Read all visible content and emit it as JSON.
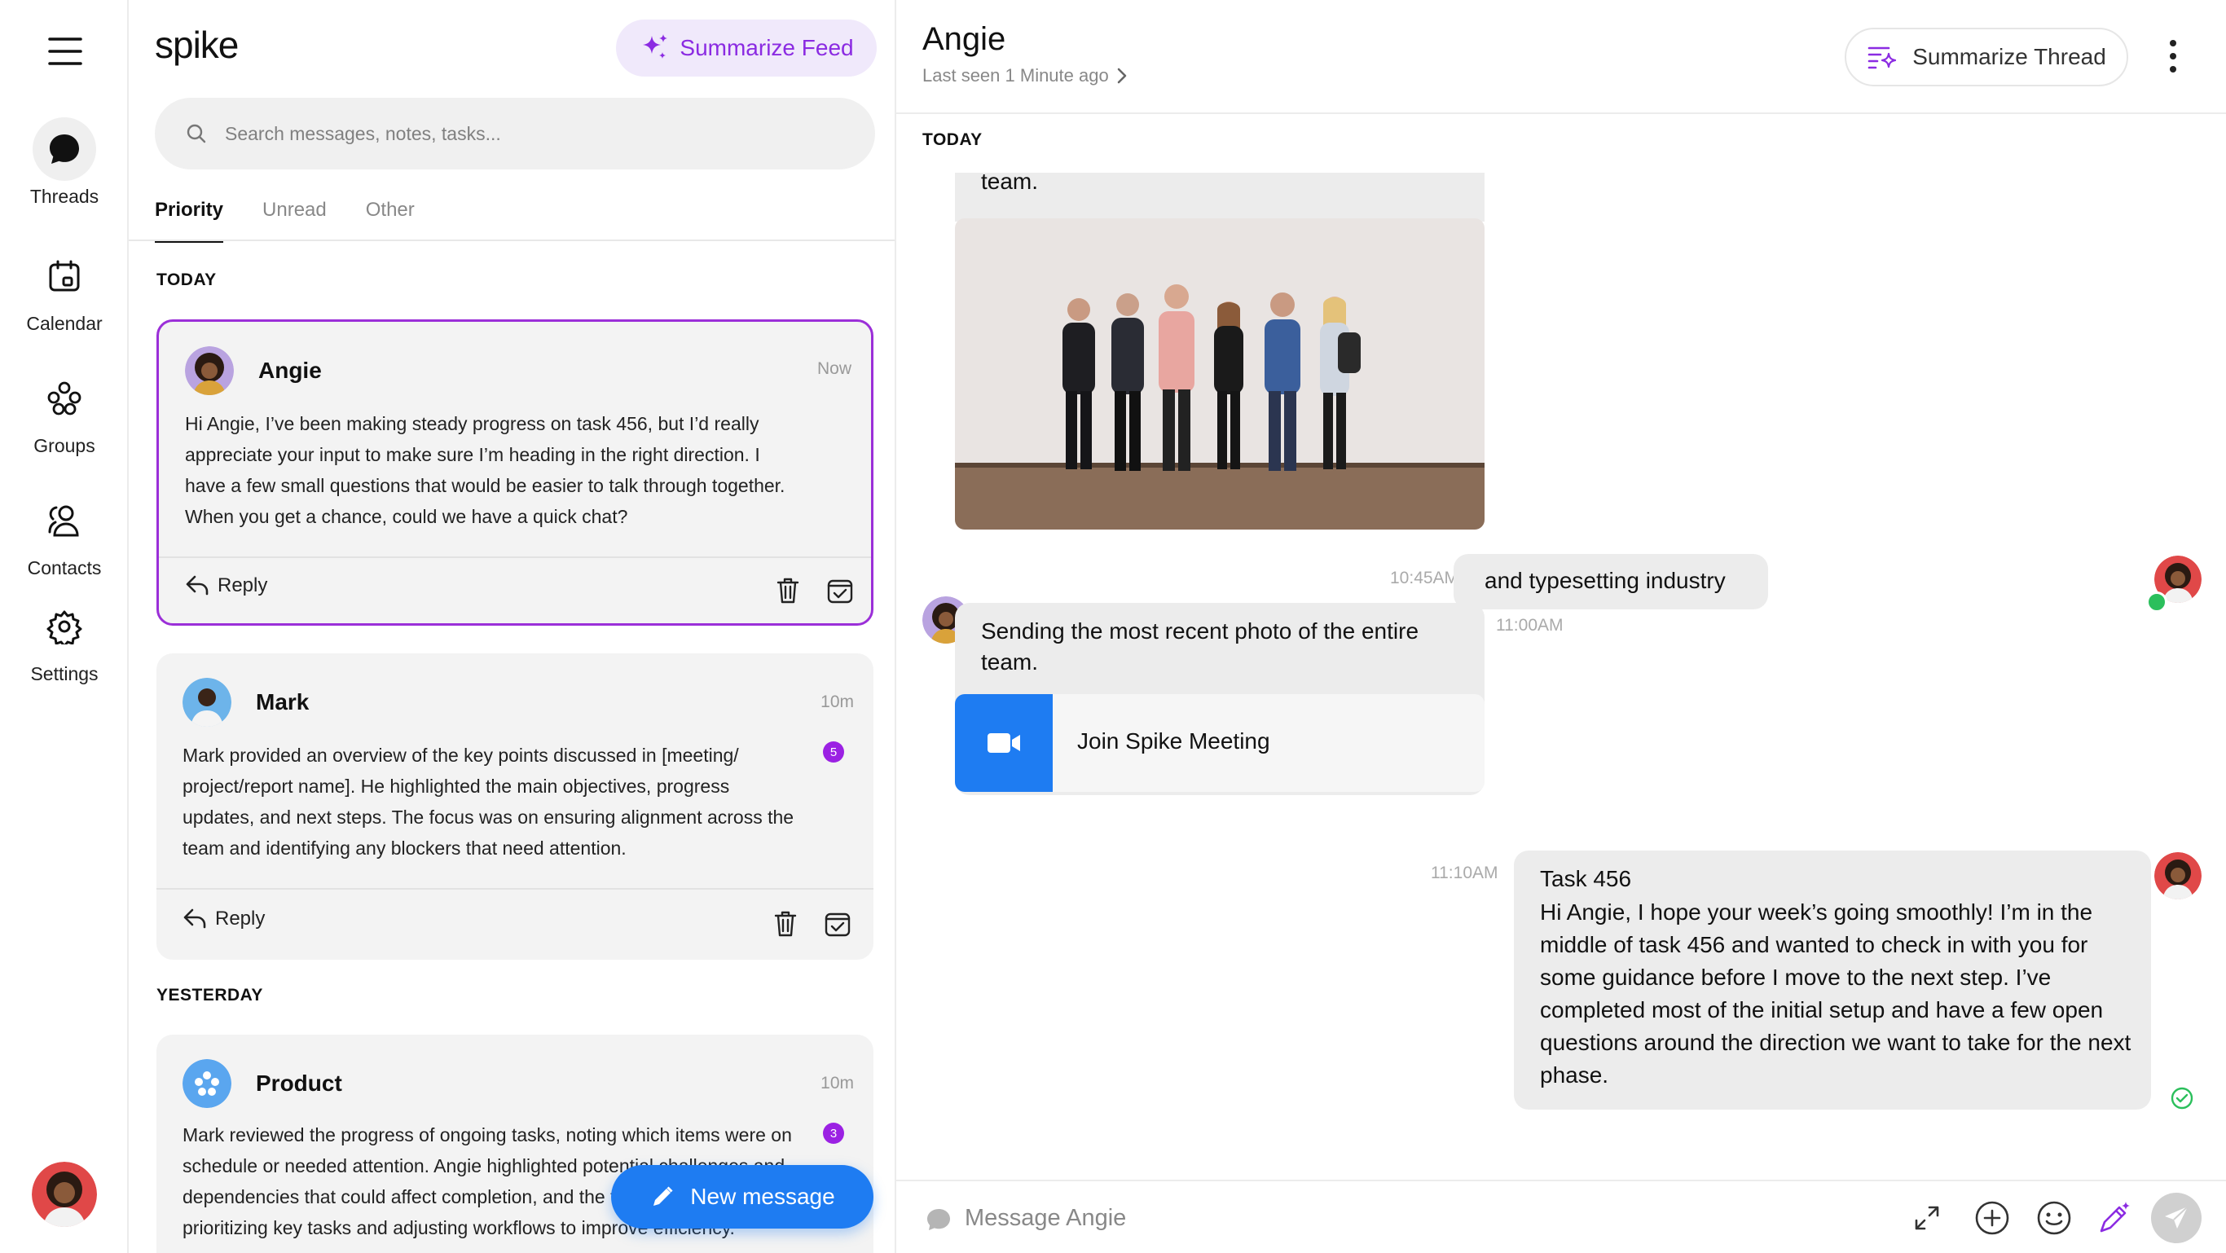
{
  "nav": {
    "items": [
      {
        "id": "threads",
        "label": "Threads",
        "icon": "chat-bubble-icon"
      },
      {
        "id": "calendar",
        "label": "Calendar",
        "icon": "calendar-icon"
      },
      {
        "id": "groups",
        "label": "Groups",
        "icon": "groups-icon"
      },
      {
        "id": "contacts",
        "label": "Contacts",
        "icon": "contacts-icon"
      },
      {
        "id": "settings",
        "label": "Settings",
        "icon": "gear-icon"
      }
    ],
    "active": "threads"
  },
  "feed": {
    "logo": "spike",
    "summarize_label": "Summarize Feed",
    "search_placeholder": "Search messages, notes, tasks...",
    "tabs": [
      "Priority",
      "Unread",
      "Other"
    ],
    "active_tab": "Priority",
    "today_label": "TODAY",
    "yesterday_label": "YESTERDAY",
    "cards": [
      {
        "name": "Angie",
        "time": "Now",
        "body": "Hi Angie, I’ve been making steady progress on task 456, but I’d really appreciate your input to make sure I’m heading in the right direction. I have a few small questions that would be easier to talk through together. When you get a chance, could we have a quick chat?",
        "reply": "Reply"
      },
      {
        "name": "Mark",
        "time": "10m",
        "badge": "5",
        "body": "Mark provided an overview of the key points discussed in [meeting/ project/report name]. He highlighted the main objectives, progress updates, and next steps. The focus was on ensuring alignment across the team and identifying any blockers that need attention.",
        "reply": "Reply"
      },
      {
        "name": "Product",
        "time": "10m",
        "badge": "3",
        "body": "Mark reviewed the progress of ongoing tasks, noting which items were on schedule or needed attention. Angie highlighted potential challenges and dependencies that could affect completion, and the team discussed prioritizing key tasks and adjusting workflows to improve efficiency."
      }
    ],
    "new_message_label": "New message"
  },
  "thread": {
    "contact_name": "Angie",
    "last_seen": "Last seen 1 Minute ago",
    "summarize_label": "Summarize Thread",
    "today_label": "TODAY",
    "messages": {
      "m0_text": "Sending the most recent photo of the entire team.",
      "m1_text": "and typesetting industry",
      "m1_time": "10:45AM",
      "m2_text": "Sending the most recent photo of the entire team.",
      "m2_time": "11:00AM",
      "meeting_label": "Join Spike Meeting",
      "m3_title": "Task 456",
      "m3_text": "Hi Angie, I hope your week’s going smoothly! I’m in the middle of task 456 and wanted to check in with you for some guidance before I move to the next step. I’ve completed most of the initial setup and have a few open questions around the direction we want to take for the next phase.",
      "m3_time": "11:10AM"
    },
    "composer_placeholder": "Message Angie"
  },
  "colors": {
    "accent_purple": "#9b2fd8",
    "primary_blue": "#1e7cf2",
    "online_green": "#2bbf5c"
  }
}
